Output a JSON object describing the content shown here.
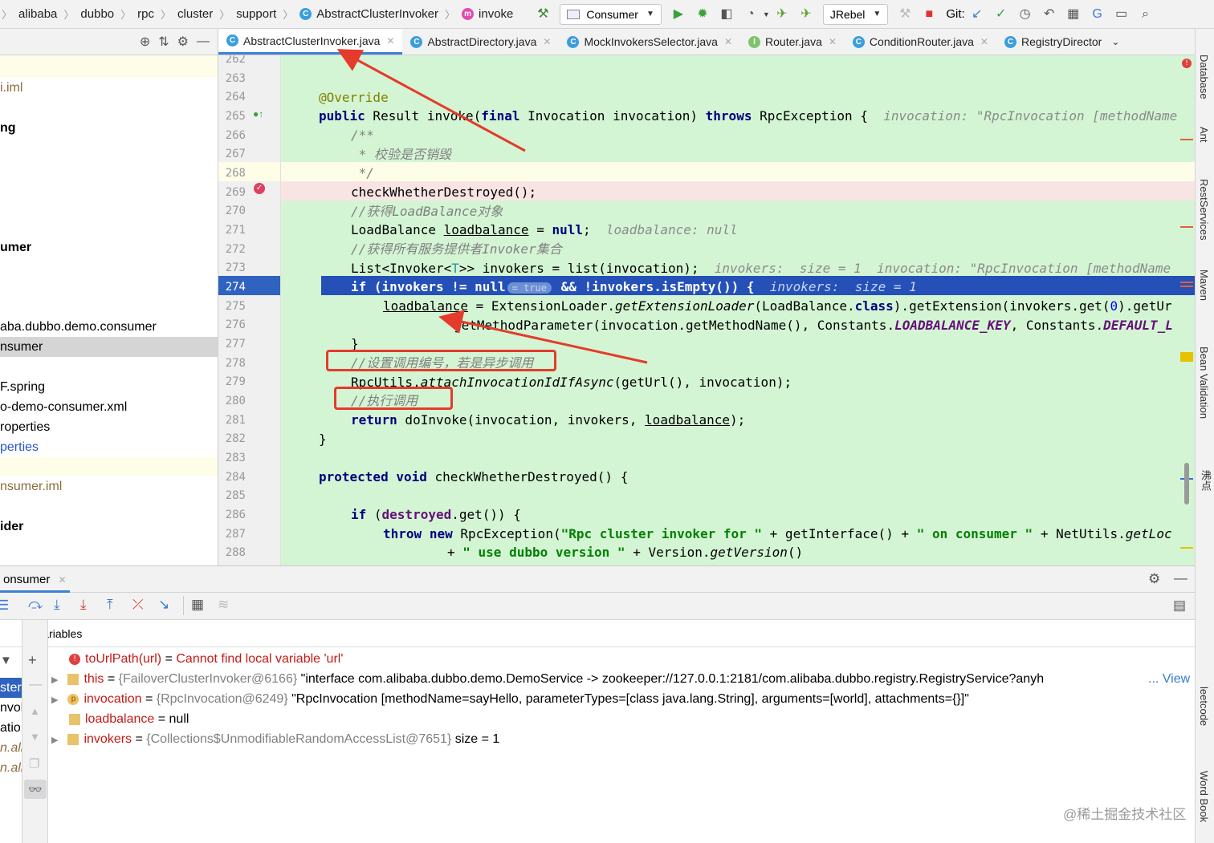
{
  "navbar": {
    "breadcrumbs": [
      "alibaba",
      "dubbo",
      "rpc",
      "cluster",
      "support",
      "AbstractClusterInvoker",
      "invoke"
    ],
    "run_config": "Consumer",
    "jrebel": "JRebel",
    "git_label": "Git:"
  },
  "tabs": [
    {
      "label": "AbstractClusterInvoker.java",
      "kind": "C",
      "active": true
    },
    {
      "label": "AbstractDirectory.java",
      "kind": "C",
      "active": false
    },
    {
      "label": "MockInvokersSelector.java",
      "kind": "C",
      "active": false
    },
    {
      "label": "Router.java",
      "kind": "I",
      "active": false
    },
    {
      "label": "ConditionRouter.java",
      "kind": "C",
      "active": false
    },
    {
      "label": "RegistryDirector",
      "kind": "C",
      "active": false
    }
  ],
  "project_tree": [
    {
      "text": "i.iml",
      "color": "#8a6d3b"
    },
    {
      "text": "ng",
      "color": "#000",
      "bold": true
    },
    {
      "text": "umer",
      "color": "#000",
      "bold": true
    },
    {
      "text": "aba.dubbo.demo.consumer",
      "color": "#000"
    },
    {
      "text": "nsumer",
      "color": "#000",
      "selected": true
    },
    {
      "text": "F.spring",
      "color": "#000"
    },
    {
      "text": "o-demo-consumer.xml",
      "color": "#000"
    },
    {
      "text": "roperties",
      "color": "#000"
    },
    {
      "text": "perties",
      "color": "#2a55c9"
    },
    {
      "text": "nsumer.iml",
      "color": "#8a6d3b"
    },
    {
      "text": "ider",
      "color": "#000",
      "bold": true
    }
  ],
  "line_numbers": [
    "262",
    "263",
    "264",
    "265",
    "266",
    "267",
    "268",
    "269",
    "270",
    "271",
    "272",
    "273",
    "274",
    "275",
    "276",
    "277",
    "278",
    "279",
    "280",
    "281",
    "282",
    "283",
    "284",
    "285",
    "286",
    "287",
    "288"
  ],
  "code": {
    "l264": "@Override",
    "l265_a": "public",
    "l265_b": " Result invoke(",
    "l265_c": "final",
    "l265_d": " Invocation invocation) ",
    "l265_e": "throws",
    "l265_f": " RpcException {  ",
    "l265_hint": "invocation: \"RpcInvocation [methodName",
    "l266": "/**",
    "l267": " * 校验是否销毁",
    "l268": " */",
    "l269": "checkWhetherDestroyed();",
    "l270": "//获得LoadBalance对象",
    "l271_a": "LoadBalance ",
    "l271_b": "loadbalance",
    "l271_c": " = ",
    "l271_d": "null",
    "l271_e": ";  ",
    "l271_hint": "loadbalance: null",
    "l272": "//获得所有服务提供者Invoker集合",
    "l273_a": "List<Invoker<",
    "l273_t": "T",
    "l273_b": ">> invokers = list(invocation);  ",
    "l273_hint": "invokers:  size = 1  invocation: \"RpcInvocation [methodName",
    "l274_a": "if",
    "l274_b": " (invokers != ",
    "l274_c": "null",
    "l274_true": "= true",
    "l274_d": " && !invokers.isEmpty()) {  ",
    "l274_hint": "invokers:  size = 1",
    "l275_a": "loadbalance",
    "l275_b": " = ExtensionLoader.",
    "l275_c": "getExtensionLoader",
    "l275_d": "(LoadBalance.",
    "l275_e": "class",
    "l275_f": ").getExtension(invokers.get(",
    "l275_g": "0",
    "l275_h": ").getUr",
    "l276_a": "getMethodParameter(invocation.getMethodName(), Constants.",
    "l276_b": "LOADBALANCE_KEY",
    "l276_c": ", Constants.",
    "l276_d": "DEFAULT_L",
    "l277": "}",
    "l278": "//设置调用编号，若是异步调用",
    "l279_a": "RpcUtils.",
    "l279_b": "attachInvocationIdIfAsync",
    "l279_c": "(getUrl(), invocation);",
    "l280": "//执行调用",
    "l281_a": "return",
    "l281_b": " doInvoke(invocation, invokers, ",
    "l281_c": "loadbalance",
    "l281_d": ");",
    "l282": "}",
    "l284_a": "protected",
    "l284_b": "void",
    "l284_c": " checkWhetherDestroyed() {",
    "l286_a": "if",
    "l286_b": " (",
    "l286_c": "destroyed",
    "l286_d": ".get()) {",
    "l287_a": "throw",
    "l287_b": "new",
    "l287_c": " RpcException(",
    "l287_d": "\"Rpc cluster invoker for \"",
    "l287_e": " + getInterface() + ",
    "l287_f": "\" on consumer \"",
    "l287_g": " + NetUtils.",
    "l287_h": "getLoc",
    "l288_a": "+ ",
    "l288_b": "\" use dubbo version \"",
    "l288_c": " + Version.",
    "l288_d": "getVersion",
    "l288_e": "()"
  },
  "right_tools": [
    "Database",
    "Ant",
    "RestServices",
    "Maven",
    "Bean Validation",
    "沸点",
    "leetcode",
    "Word Book"
  ],
  "debug": {
    "session_tab": "onsumer",
    "variables_title": "Variables",
    "frames": [
      "ster",
      "nvol",
      "atio",
      "n.ali",
      "n.ali"
    ],
    "vars": [
      {
        "icon": "error",
        "name": "toUrlPath(url)",
        "eq": " = ",
        "type": "",
        "value": "Cannot find local variable 'url'",
        "value_color": "#c41a16",
        "expandable": false
      },
      {
        "icon": "field",
        "name": "this",
        "eq": " = ",
        "type": "{FailoverClusterInvoker@6166}",
        "value": " \"interface com.alibaba.dubbo.demo.DemoService -> zookeeper://127.0.0.1:2181/com.alibaba.dubbo.registry.RegistryService?anyh",
        "value_color": "#000",
        "expandable": true,
        "view": "... View"
      },
      {
        "icon": "param",
        "name": "invocation",
        "eq": " = ",
        "type": "{RpcInvocation@6249}",
        "value": " \"RpcInvocation [methodName=sayHello, parameterTypes=[class java.lang.String], arguments=[world], attachments={}]\"",
        "value_color": "#000",
        "expandable": true
      },
      {
        "icon": "field",
        "name": "loadbalance",
        "eq": " = ",
        "type": "",
        "value": "null",
        "value_color": "#000",
        "expandable": false
      },
      {
        "icon": "field",
        "name": "invokers",
        "eq": " = ",
        "type": "{Collections$UnmodifiableRandomAccessList@7651}",
        "value": "  size = 1",
        "value_color": "#000",
        "expandable": true
      }
    ]
  },
  "watermark": "@稀土掘金技术社区"
}
